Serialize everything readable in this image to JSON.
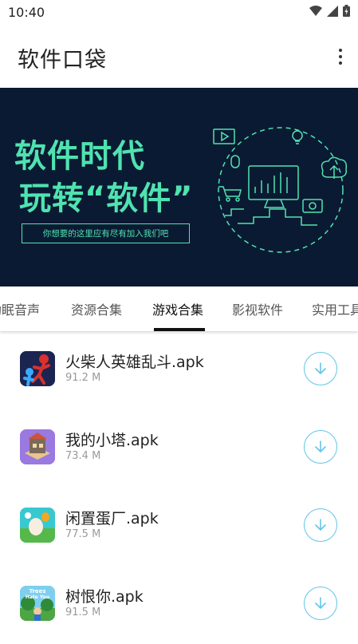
{
  "status": {
    "time": "10:40"
  },
  "app_bar": {
    "title": "软件口袋"
  },
  "banner": {
    "line1": "软件时代",
    "line2": "玩转“软件”",
    "subtitle": "你想要的这里应有尽有加入我们吧"
  },
  "tabs": [
    {
      "label": "助眠音声"
    },
    {
      "label": "资源合集"
    },
    {
      "label": "游戏合集",
      "active": true
    },
    {
      "label": "影视软件"
    },
    {
      "label": "实用工具"
    }
  ],
  "apps": [
    {
      "name": "火柴人英雄乱斗.apk",
      "size": "91.2 M",
      "icon": "stickman-hero-app-icon"
    },
    {
      "name": "我的小塔.apk",
      "size": "73.4 M",
      "icon": "my-tower-app-icon"
    },
    {
      "name": "闲置蛋厂.apk",
      "size": "77.5 M",
      "icon": "idle-egg-factory-app-icon"
    },
    {
      "name": "树恨你.apk",
      "size": "91.5 M",
      "icon": "trees-hate-you-app-icon",
      "icon_text": "Trees Hate You"
    }
  ],
  "colors": {
    "banner_bg": "#0b1a33",
    "banner_accent": "#4fe3b0",
    "download_outline": "#63c4e8"
  }
}
